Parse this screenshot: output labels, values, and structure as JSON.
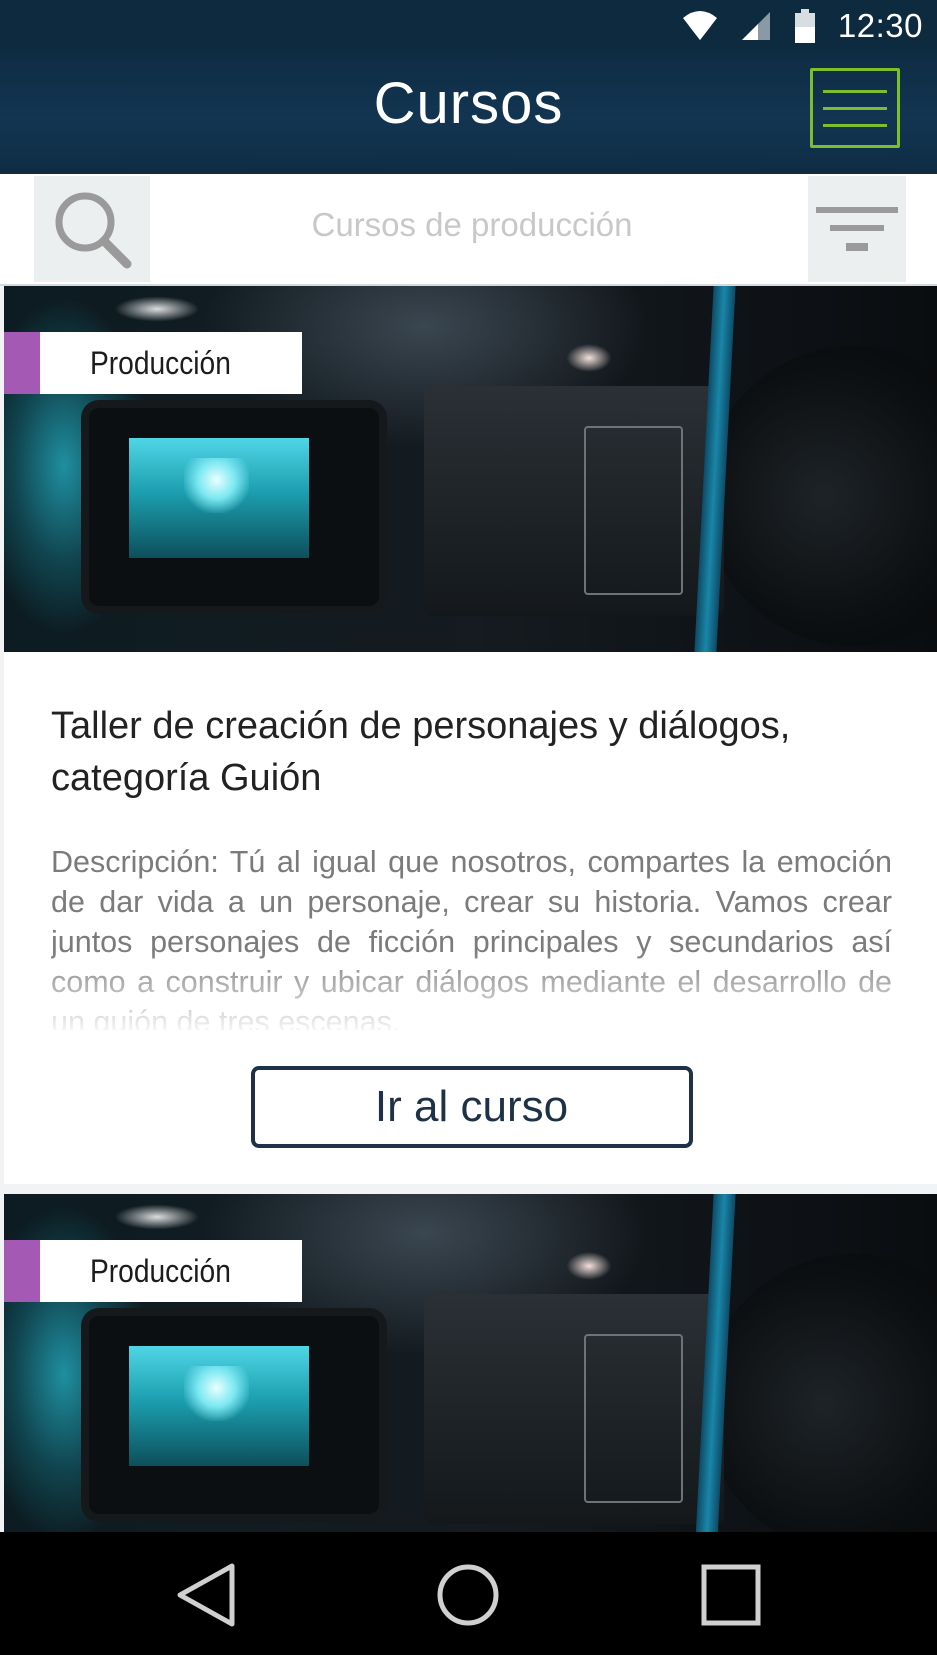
{
  "status_bar": {
    "time": "12:30",
    "icons": [
      "wifi-icon",
      "signal-icon",
      "battery-icon"
    ]
  },
  "app_bar": {
    "title": "Cursos",
    "menu_icon": "hamburger-menu-icon",
    "accent_color": "#7dbe2c"
  },
  "search": {
    "placeholder": "Cursos de producción",
    "search_icon": "search-icon",
    "filter_icon": "filter-icon"
  },
  "courses": [
    {
      "category": "Producción",
      "category_color": "#a45ab5",
      "title": "Taller de creación de personajes y diálogos, categoría Guión",
      "description": "Descripción: Tú al igual que nosotros, compartes la emoción de dar vida a un personaje, crear su historia. Vamos crear juntos personajes de ficción principales y secundarios así como a construir y ubicar diálogos mediante el desarrollo de un guión de tres escenas.",
      "button_label": "Ir al curso"
    },
    {
      "category": "Producción",
      "category_color": "#a45ab5"
    }
  ],
  "nav_bar": {
    "icons": [
      "back-icon",
      "home-icon",
      "recents-icon"
    ]
  }
}
